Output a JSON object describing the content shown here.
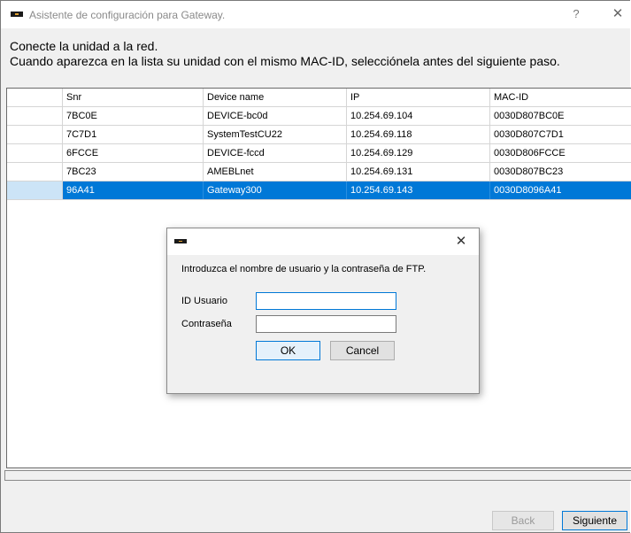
{
  "window": {
    "title": "Asistente de configuración para Gateway.",
    "help_glyph": "?",
    "close_glyph": "✕"
  },
  "instructions": {
    "line1": "Conecte la unidad a la red.",
    "line2": "Cuando aparezca en la lista su unidad con el mismo MAC-ID, selecciónela antes del siguiente paso."
  },
  "grid": {
    "columns": [
      "Snr",
      "Device name",
      "IP",
      "MAC-ID"
    ],
    "rows": [
      {
        "snr": "7BC0E",
        "device": "DEVICE-bc0d",
        "ip": "10.254.69.104",
        "mac": "0030D807BC0E"
      },
      {
        "snr": "7C7D1",
        "device": "SystemTestCU22",
        "ip": "10.254.69.118",
        "mac": "0030D807C7D1"
      },
      {
        "snr": "6FCCE",
        "device": "DEVICE-fccd",
        "ip": "10.254.69.129",
        "mac": "0030D806FCCE"
      },
      {
        "snr": "7BC23",
        "device": "AMEBLnet",
        "ip": "10.254.69.131",
        "mac": "0030D807BC23"
      },
      {
        "snr": "96A41",
        "device": "Gateway300",
        "ip": "10.254.69.143",
        "mac": "0030D8096A41"
      }
    ],
    "selected_row": 4
  },
  "buttons": {
    "back": "Back",
    "next": "Siguiente"
  },
  "dialog": {
    "close_glyph": "✕",
    "message": "Introduzca el nombre de usuario y la contraseña de FTP.",
    "user_label": "ID Usuario",
    "password_label": "Contraseña",
    "user_value": "",
    "password_value": "",
    "ok": "OK",
    "cancel": "Cancel"
  },
  "colors": {
    "selection": "#0078d7",
    "selection_text": "#ffffff",
    "focus_border": "#0078d7"
  }
}
